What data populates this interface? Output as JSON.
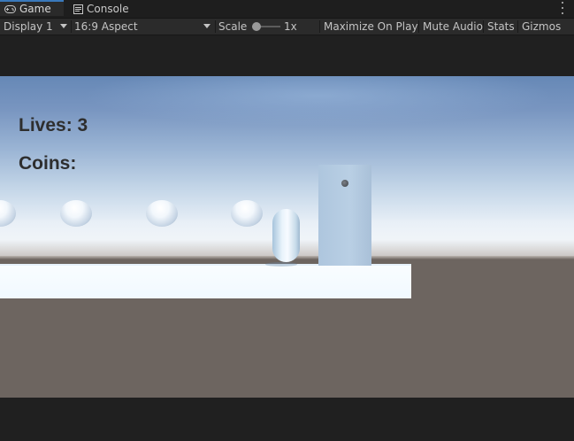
{
  "tabs": [
    {
      "label": "Game",
      "icon": "gamepad-icon",
      "active": true
    },
    {
      "label": "Console",
      "icon": "console-icon",
      "active": false
    }
  ],
  "toolbar": {
    "display": "Display 1",
    "aspect": "16:9 Aspect",
    "scale_label": "Scale",
    "scale_value": "1x",
    "maximize_on_play": "Maximize On Play",
    "mute_audio": "Mute Audio",
    "stats": "Stats",
    "gizmos": "Gizmos"
  },
  "hud": {
    "lives_label": "Lives: 3",
    "coins_label": "Coins:"
  },
  "colors": {
    "editor_bg": "#202020",
    "toolbar_bg": "#2b2b2b",
    "text": "#c4c4c4",
    "hud_text": "#2e2e2e",
    "ground": "#6d6560",
    "platform": "#f5fbff",
    "door": "#b4cbe1"
  }
}
